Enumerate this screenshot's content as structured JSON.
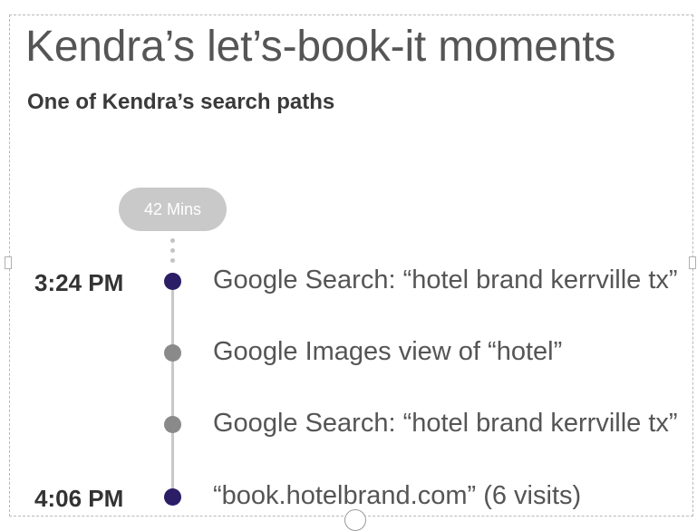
{
  "header": {
    "title": "Kendra’s let’s-book-it moments",
    "subtitle": "One of Kendra’s search paths"
  },
  "timeline": {
    "duration_label": "42 Mins",
    "events": [
      {
        "time": "3:24 PM",
        "label": "Google Search: “hotel brand kerrville tx”",
        "marker": "key"
      },
      {
        "time": "",
        "label": "Google Images view of “hotel”",
        "marker": "mid"
      },
      {
        "time": "",
        "label": "Google Search: “hotel brand kerrville tx”",
        "marker": "mid"
      },
      {
        "time": "4:06 PM",
        "label": "“book.hotelbrand.com” (6 visits)",
        "marker": "key"
      }
    ]
  },
  "colors": {
    "key_marker": "#2b1d66",
    "mid_marker": "#8a8a8a",
    "line": "#c8c8c8",
    "pill": "#c9c9c9"
  }
}
